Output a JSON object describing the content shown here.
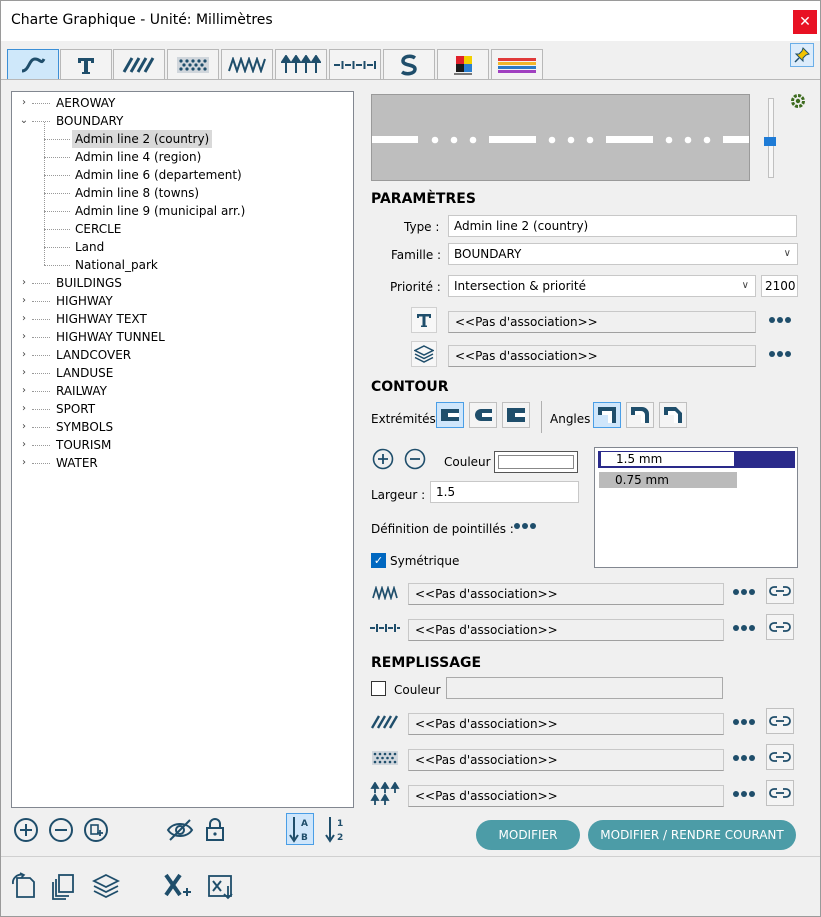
{
  "window": {
    "title": "Charte Graphique - Unité: Millimètres",
    "close_label": "✕"
  },
  "tabs": [
    {
      "icon": "line-style-icon"
    },
    {
      "icon": "text-style-icon"
    },
    {
      "icon": "hatch-pattern-icon"
    },
    {
      "icon": "dot-pattern-icon"
    },
    {
      "icon": "zigzag-line-icon"
    },
    {
      "icon": "arrow-symbols-icon"
    },
    {
      "icon": "dash-dot-line-icon"
    },
    {
      "icon": "s-curve-icon"
    },
    {
      "icon": "color-palette-icon"
    },
    {
      "icon": "color-ramp-icon"
    }
  ],
  "tree": {
    "groups": [
      {
        "label": "AEROWAY",
        "expanded": false
      },
      {
        "label": "BOUNDARY",
        "expanded": true,
        "children": [
          "Admin line 2 (country)",
          "Admin line 4 (region)",
          "Admin line 6 (departement)",
          "Admin line 8 (towns)",
          "Admin line 9 (municipal arr.)",
          "CERCLE",
          "Land",
          "National_park"
        ]
      },
      {
        "label": "BUILDINGS",
        "expanded": false
      },
      {
        "label": "HIGHWAY",
        "expanded": false
      },
      {
        "label": "HIGHWAY TEXT",
        "expanded": false
      },
      {
        "label": "HIGHWAY TUNNEL",
        "expanded": false
      },
      {
        "label": "LANDCOVER",
        "expanded": false
      },
      {
        "label": "LANDUSE",
        "expanded": false
      },
      {
        "label": "RAILWAY",
        "expanded": false
      },
      {
        "label": "SPORT",
        "expanded": false
      },
      {
        "label": "SYMBOLS",
        "expanded": false
      },
      {
        "label": "TOURISM",
        "expanded": false
      },
      {
        "label": "WATER",
        "expanded": false
      }
    ],
    "selected": "Admin line 2 (country)"
  },
  "params": {
    "title": "PARAMÈTRES",
    "type_label": "Type :",
    "type_value": "Admin line 2 (country)",
    "famille_label": "Famille :",
    "famille_value": "BOUNDARY",
    "priorite_label": "Priorité :",
    "priorite_value": "Intersection & priorité",
    "priorite_num": "2100",
    "text_assoc": "<<Pas d'association>>",
    "layer_assoc": "<<Pas d'association>>"
  },
  "contour": {
    "title": "CONTOUR",
    "extremites_label": "Extrémités",
    "angles_label": "Angles",
    "couleur_label": "Couleur",
    "largeur_label": "Largeur :",
    "largeur_value": "1.5",
    "pointilles_label": "Définition de pointillés :",
    "symetrique_label": "Symétrique",
    "symetrique_checked": true,
    "widths": [
      "1.5 mm",
      "0.75 mm"
    ],
    "zigzag_assoc": "<<Pas d'association>>",
    "dashdot_assoc": "<<Pas d'association>>"
  },
  "remplissage": {
    "title": "REMPLISSAGE",
    "couleur_label": "Couleur",
    "couleur_checked": false,
    "hatch_assoc": "<<Pas d'association>>",
    "dots_assoc": "<<Pas d'association>>",
    "arrows_assoc": "<<Pas d'association>>"
  },
  "actions": {
    "modifier": "MODIFIER",
    "modifier_courant": "MODIFIER / RENDRE COURANT"
  },
  "colors": {
    "accent": "#4c9ca7",
    "icon": "#1f4e6b",
    "selection": "#2a2a8a"
  }
}
